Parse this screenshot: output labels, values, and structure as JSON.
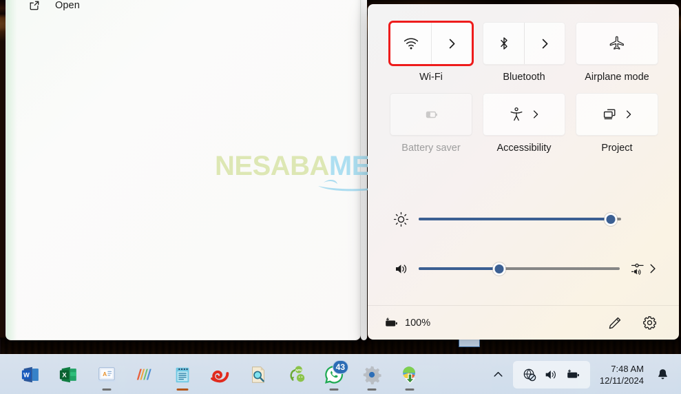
{
  "context_menu": {
    "items": [
      {
        "label": "Open",
        "icon": "open-external-icon"
      }
    ]
  },
  "watermark": {
    "part1": "NESABA",
    "part2": "MEDIA"
  },
  "quick_settings": {
    "tiles": [
      {
        "id": "wifi",
        "label": "Wi-Fi",
        "icon": "wifi-icon",
        "has_chevron": true,
        "split": true,
        "enabled": true,
        "highlighted": true
      },
      {
        "id": "bluetooth",
        "label": "Bluetooth",
        "icon": "bluetooth-icon",
        "has_chevron": true,
        "split": true,
        "enabled": true,
        "highlighted": false
      },
      {
        "id": "airplane",
        "label": "Airplane mode",
        "icon": "airplane-icon",
        "has_chevron": false,
        "split": false,
        "enabled": true,
        "highlighted": false
      },
      {
        "id": "battery-saver",
        "label": "Battery saver",
        "icon": "battery-saver-icon",
        "has_chevron": false,
        "split": false,
        "enabled": false,
        "highlighted": false
      },
      {
        "id": "accessibility",
        "label": "Accessibility",
        "icon": "accessibility-icon",
        "has_chevron": true,
        "split": false,
        "enabled": true,
        "highlighted": false
      },
      {
        "id": "project",
        "label": "Project",
        "icon": "project-icon",
        "has_chevron": true,
        "split": false,
        "enabled": true,
        "highlighted": false
      }
    ],
    "sliders": [
      {
        "id": "brightness",
        "icon": "brightness-icon",
        "value": 95,
        "tail_icon": null
      },
      {
        "id": "volume",
        "icon": "volume-icon",
        "value": 40,
        "tail_icon": "audio-output-selector-icon"
      }
    ],
    "footer": {
      "battery_icon": "battery-charging-icon",
      "battery_percent": "100%",
      "edit_icon": "pencil-icon",
      "settings_icon": "gear-icon"
    },
    "accent_color": "#3b5f92",
    "highlight_color": "#ee1c1c"
  },
  "taskbar": {
    "apps": [
      {
        "id": "word",
        "name": "word-icon",
        "running": false,
        "active": false,
        "badge": null
      },
      {
        "id": "excel",
        "name": "excel-icon",
        "running": false,
        "active": false,
        "badge": null
      },
      {
        "id": "wps-writer",
        "name": "wps-writer-icon",
        "running": true,
        "active": false,
        "badge": null
      },
      {
        "id": "stripes",
        "name": "stripes-app-icon",
        "running": false,
        "active": false,
        "badge": null
      },
      {
        "id": "notepad",
        "name": "notepad-icon",
        "running": true,
        "active": true,
        "badge": null
      },
      {
        "id": "snail",
        "name": "snail-app-icon",
        "running": false,
        "active": false,
        "badge": null
      },
      {
        "id": "doc-search",
        "name": "document-search-icon",
        "running": false,
        "active": false,
        "badge": null
      },
      {
        "id": "apk-tool",
        "name": "android-converter-icon",
        "running": false,
        "active": false,
        "badge": null
      },
      {
        "id": "whatsapp",
        "name": "whatsapp-icon",
        "running": true,
        "active": false,
        "badge": "43"
      },
      {
        "id": "settings-app",
        "name": "settings-gear-app-icon",
        "running": true,
        "active": false,
        "badge": null
      },
      {
        "id": "idm",
        "name": "download-manager-icon",
        "running": true,
        "active": false,
        "badge": null
      }
    ],
    "tray": {
      "chevron_icon": "chevron-up-icon",
      "icons": [
        {
          "name": "network-disconnected-icon"
        },
        {
          "name": "speaker-icon"
        },
        {
          "name": "battery-charging-icon"
        }
      ],
      "time": "7:48 AM",
      "date": "12/11/2024",
      "notification_icon": "bell-icon"
    }
  }
}
